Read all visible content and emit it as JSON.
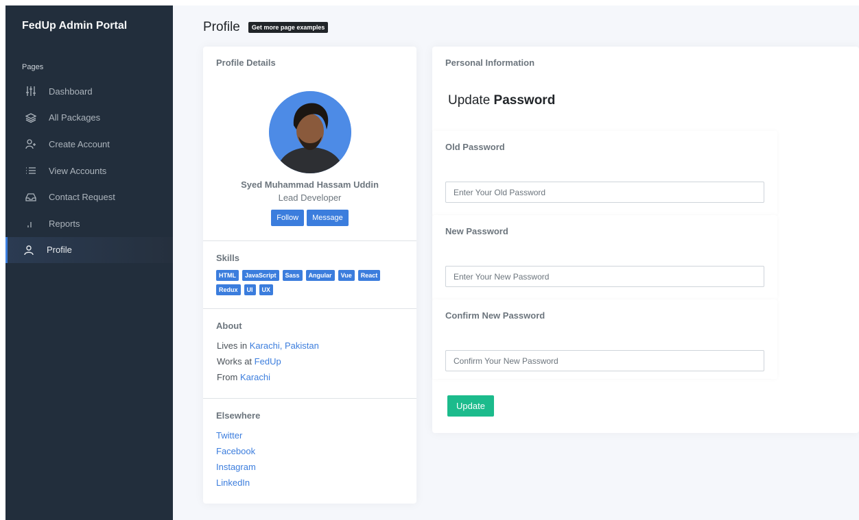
{
  "brand": "FedUp Admin Portal",
  "nav": {
    "header": "Pages",
    "items": [
      {
        "label": "Dashboard",
        "icon": "sliders-icon"
      },
      {
        "label": "All Packages",
        "icon": "layers-icon"
      },
      {
        "label": "Create Account",
        "icon": "user-plus-icon"
      },
      {
        "label": "View Accounts",
        "icon": "list-icon"
      },
      {
        "label": "Contact Request",
        "icon": "inbox-icon"
      },
      {
        "label": "Reports",
        "icon": "bar-chart-icon"
      },
      {
        "label": "Profile",
        "icon": "user-icon",
        "active": true
      }
    ]
  },
  "page": {
    "title": "Profile",
    "badge": "Get more page examples"
  },
  "profile": {
    "header": "Profile Details",
    "name": "Syed Muhammad Hassam Uddin",
    "role": "Lead Developer",
    "follow_label": "Follow",
    "message_label": "Message",
    "skills_title": "Skills",
    "skills": [
      "HTML",
      "JavaScript",
      "Sass",
      "Angular",
      "Vue",
      "React",
      "Redux",
      "UI",
      "UX"
    ],
    "about_title": "About",
    "about": {
      "lives_prefix": "Lives in ",
      "lives_link": "Karachi, Pakistan",
      "works_prefix": "Works at ",
      "works_link": "FedUp",
      "from_prefix": "From ",
      "from_link": "Karachi"
    },
    "elsewhere_title": "Elsewhere",
    "elsewhere": [
      "Twitter",
      "Facebook",
      "Instagram",
      "LinkedIn"
    ]
  },
  "personal": {
    "header": "Personal Information",
    "heading_prefix": "Update ",
    "heading_bold": "Password",
    "old_label": "Old Password",
    "old_placeholder": "Enter Your Old Password",
    "new_label": "New Password",
    "new_placeholder": "Enter Your New Password",
    "confirm_label": "Confirm New Password",
    "confirm_placeholder": "Confirm Your New Password",
    "update_label": "Update"
  },
  "colors": {
    "sidebar": "#222e3c",
    "primary": "#3b7ddd",
    "success": "#1cbb8c"
  }
}
